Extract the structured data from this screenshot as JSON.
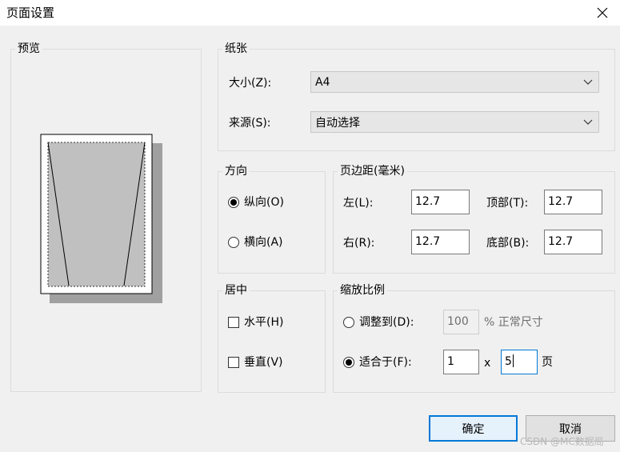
{
  "window": {
    "title": "页面设置",
    "close_label": "×"
  },
  "preview": {
    "legend": "预览"
  },
  "paper": {
    "legend": "纸张",
    "size_label": "大小(Z):",
    "size_value": "A4",
    "source_label": "来源(S):",
    "source_value": "自动选择"
  },
  "orientation": {
    "legend": "方向",
    "portrait_label": "纵向(O)",
    "landscape_label": "横向(A)",
    "selected": "portrait"
  },
  "margins": {
    "legend": "页边距(毫米)",
    "left_label": "左(L):",
    "left_value": "12.7",
    "top_label": "顶部(T):",
    "top_value": "12.7",
    "right_label": "右(R):",
    "right_value": "12.7",
    "bottom_label": "底部(B):",
    "bottom_value": "12.7"
  },
  "center": {
    "legend": "居中",
    "horizontal_label": "水平(H)",
    "vertical_label": "垂直(V)",
    "horizontal_checked": false,
    "vertical_checked": false
  },
  "scale": {
    "legend": "缩放比例",
    "adjust_label": "调整到(D):",
    "adjust_value": "100",
    "adjust_suffix": "% 正常尺寸",
    "fit_label": "适合于(F):",
    "fit_wide_value": "1",
    "fit_x": "x",
    "fit_tall_value": "5",
    "fit_suffix": "页",
    "selected": "fit"
  },
  "buttons": {
    "ok_label": "确定",
    "cancel_label": "取消"
  },
  "watermark": "CSDN @MC数据局",
  "colors": {
    "accent": "#0078d7",
    "preview_fill": "#c0c0c0",
    "preview_shadow": "#a0a0a0"
  }
}
